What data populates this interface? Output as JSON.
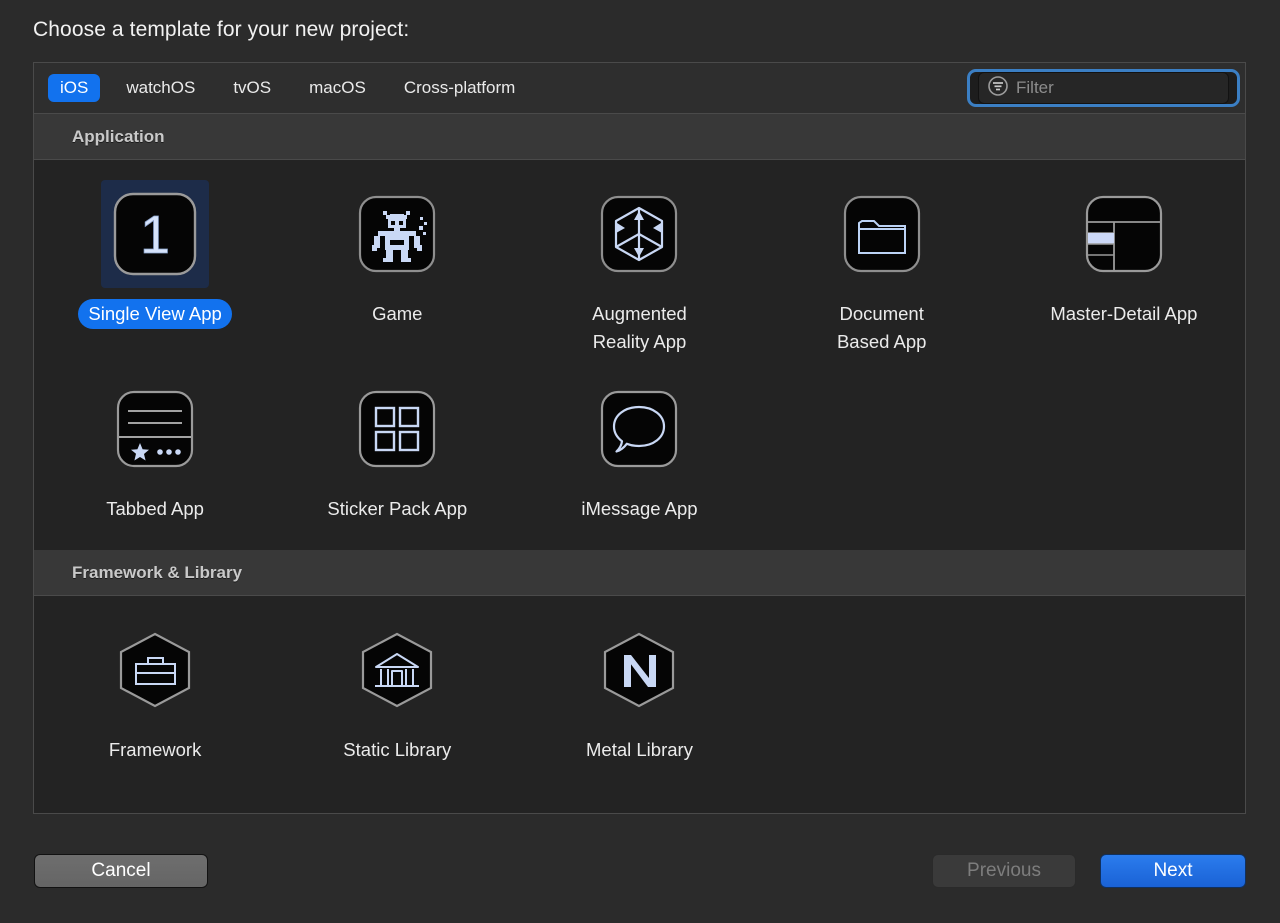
{
  "dialog": {
    "title": "Choose a template for your new project:"
  },
  "platform_tabs": [
    {
      "label": "iOS",
      "selected": true
    },
    {
      "label": "watchOS",
      "selected": false
    },
    {
      "label": "tvOS",
      "selected": false
    },
    {
      "label": "macOS",
      "selected": false
    },
    {
      "label": "Cross-platform",
      "selected": false
    }
  ],
  "filter": {
    "icon": "filter-icon",
    "value": "",
    "placeholder": "Filter",
    "focused": true
  },
  "sections": [
    {
      "header": "Application",
      "templates": [
        {
          "label": "Single View App",
          "icon": "single-view-app-icon",
          "selected": true
        },
        {
          "label": "Game",
          "icon": "game-robot-icon",
          "selected": false
        },
        {
          "label": "Augmented\nReality App",
          "icon": "augmented-reality-cube-icon",
          "selected": false
        },
        {
          "label": "Document\nBased App",
          "icon": "document-folder-icon",
          "selected": false
        },
        {
          "label": "Master-Detail App",
          "icon": "master-detail-split-icon",
          "selected": false
        },
        {
          "label": "Tabbed App",
          "icon": "tabbed-app-icon",
          "selected": false
        },
        {
          "label": "Sticker Pack App",
          "icon": "sticker-pack-grid-icon",
          "selected": false
        },
        {
          "label": "iMessage App",
          "icon": "imessage-bubble-icon",
          "selected": false
        }
      ]
    },
    {
      "header": "Framework & Library",
      "templates": [
        {
          "label": "Framework",
          "icon": "framework-toolbox-hexagon-icon",
          "selected": false
        },
        {
          "label": "Static Library",
          "icon": "static-library-building-hexagon-icon",
          "selected": false
        },
        {
          "label": "Metal Library",
          "icon": "metal-library-m-hexagon-icon",
          "selected": false
        }
      ]
    }
  ],
  "footer": {
    "cancel_label": "Cancel",
    "previous_label": "Previous",
    "previous_disabled": true,
    "next_label": "Next",
    "next_default": true
  },
  "colors": {
    "accent_blue": "#1272ee",
    "selection_fill": "#1d2c49",
    "panel_background": "#232323",
    "section_header": "#383838",
    "window_background": "#2b2b2b",
    "icon_stroke": "#c9d8f5",
    "focus_ring": "#3b7fc4",
    "disabled_text": "#7d7d7d"
  }
}
